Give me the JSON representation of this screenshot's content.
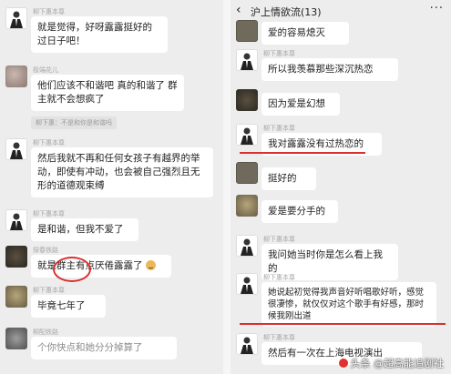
{
  "left": {
    "messages": [
      {
        "nick": "柳下惠本尊",
        "text": "就是觉得，好呀露露挺好的 过日子吧！"
      },
      {
        "nick": "极端花儿",
        "text": "他们应该不和谐吧 真的和谐了 群主就不会想疯了",
        "quote": "柳下惠：不是和你是和谐吗"
      },
      {
        "nick": "柳下惠本尊",
        "text": "然后我就不再和任何女孩子有越界的举动，即使有冲动，也会被自己强烈且无形的道德观束缚"
      },
      {
        "nick": "柳下惠本尊",
        "text": "是和谐，但我不爱了"
      },
      {
        "nick": "探春铁路",
        "text": "就是群主有点厌倦露露了"
      },
      {
        "nick": "柳下惠本尊",
        "text": "毕竟七年了"
      },
      {
        "nick": "柳配铁路",
        "text": "个你快点和她分分掉算了"
      }
    ]
  },
  "right": {
    "header": {
      "back": "‹",
      "title": "沪上情欲流",
      "count": "(13)",
      "more": "···"
    },
    "messages": [
      {
        "nick": "",
        "text": "爱的容易熄灭"
      },
      {
        "nick": "柳下惠本尊",
        "text": "所以我羡慕那些深沉热恋"
      },
      {
        "nick": "",
        "text": "因为爱是幻想"
      },
      {
        "nick": "柳下惠本尊",
        "text": "我对露露没有过热恋的"
      },
      {
        "nick": "",
        "text": "挺好的"
      },
      {
        "nick": "",
        "text": "爱是要分手的"
      },
      {
        "nick": "柳下惠本尊",
        "text": "我问她当时你是怎么看上我的"
      },
      {
        "nick": "柳下惠本尊",
        "text": "她说起初觉得我声音好听唱歌好听，感觉很凄惨，就仅仅对这个歌手有好感，那时候我刚出道"
      },
      {
        "nick": "柳下惠本尊",
        "text": "然后有一次在上海电视演出"
      }
    ]
  },
  "watermark": "头条 @超高能追剧社",
  "colors": {
    "underline": "#d93030",
    "bubble": "#ffffff",
    "background": "#ededed"
  }
}
